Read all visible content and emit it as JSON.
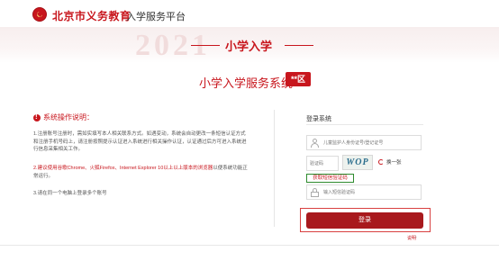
{
  "header": {
    "site_title": "北京市义务教育",
    "site_subtitle": "入学服务平台"
  },
  "banner": {
    "year": "2021",
    "title": "小学入学"
  },
  "system": {
    "title": "小学入学服务系统",
    "district": "**区"
  },
  "instructions": {
    "title": "系统操作说明：",
    "note1": "1.注册账号注册时，需如实填写本人相关联系方式。如遇变动，系统会自动更改一条短信认证方式和注册手机号码上，请注册按照提示认证进入系统进行相关操作认证，认证通过后方可进入系统进行信息采集相关工作。",
    "note2_prefix": "2.建议使用谷歌Chrome、火狐Firefox、Internet Explorer 10以上以上版本的浏览器",
    "note2_suffix": "以便系统功能正常运行。",
    "note3": "3.请在同一个电脑上登录多个账号"
  },
  "login": {
    "title": "登录系统",
    "id_placeholder": "儿童监护人身份证号/登记证号",
    "captcha_placeholder": "验证码",
    "captcha_text": "WOP",
    "refresh_label": "换一张",
    "sms_link": "获取短信验证码",
    "sms_placeholder": "输入短信验证码",
    "button_label": "登录",
    "help_label": "说明",
    "help_arrow": "›"
  },
  "colors": {
    "brand_red": "#c8161d",
    "button_red": "#a8191d",
    "highlight_green": "#2e8b2e"
  }
}
